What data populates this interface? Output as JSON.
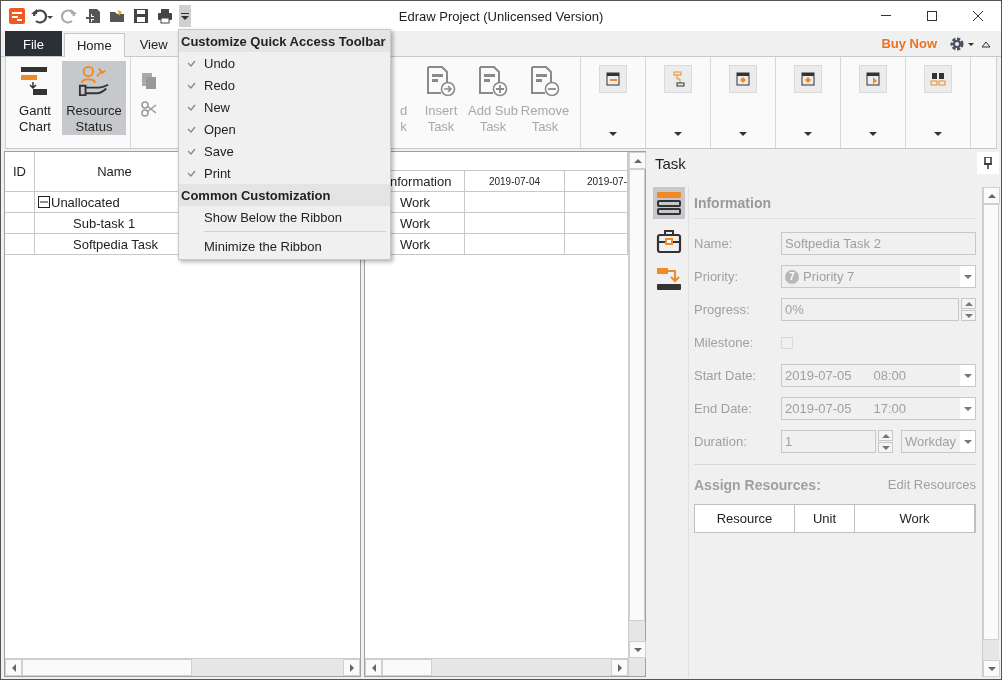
{
  "window": {
    "title": "Edraw Project (Unlicensed Version)"
  },
  "tabs": [
    {
      "label": "File",
      "kind": "file",
      "selected": false
    },
    {
      "label": "Home",
      "kind": "tab",
      "selected": true
    },
    {
      "label": "View",
      "kind": "tab",
      "selected": false
    }
  ],
  "buy_now": "Buy Now",
  "ribbon": {
    "view_buttons": [
      {
        "lines": [
          "Gantt",
          "Chart"
        ],
        "kind": "gantt",
        "selected": false
      },
      {
        "lines": [
          "Resource",
          "Status"
        ],
        "kind": "resource",
        "selected": true
      }
    ],
    "task_buttons": [
      {
        "lines": [
          "d",
          "k"
        ],
        "kind": "partial"
      },
      {
        "lines": [
          "Insert",
          "Task"
        ],
        "kind": "insert"
      },
      {
        "lines": [
          "Add Sub",
          "Task"
        ],
        "kind": "add"
      },
      {
        "lines": [
          "Remove",
          "Task"
        ],
        "kind": "remove"
      }
    ],
    "dropdown_groups": [
      {
        "kind": "bar"
      },
      {
        "kind": "link"
      },
      {
        "kind": "diamond"
      },
      {
        "kind": "diamond"
      },
      {
        "kind": "flag"
      },
      {
        "kind": "find"
      }
    ]
  },
  "task_table": {
    "columns": [
      "ID",
      "Name"
    ],
    "rows": [
      {
        "name": "Unallocated",
        "expanded": true,
        "children": [
          {
            "name": "Sub-task 1"
          },
          {
            "name": "Softpedia Task"
          }
        ]
      }
    ]
  },
  "gantt": {
    "columns": [
      "nformation",
      "2019-07-04",
      "2019-07-"
    ],
    "rows": [
      {
        "information": "Work"
      },
      {
        "information": "Work"
      },
      {
        "information": "Work"
      }
    ]
  },
  "task_panel": {
    "title": "Task",
    "side_tabs": [
      {
        "kind": "info",
        "selected": true
      },
      {
        "kind": "case",
        "selected": false
      },
      {
        "kind": "link",
        "selected": false
      }
    ],
    "section": "Information",
    "fields": [
      {
        "label": "Name:",
        "kind": "text",
        "value": "Softpedia Task 2"
      },
      {
        "label": "Priority:",
        "kind": "select",
        "badge": "7",
        "value": "Priority 7"
      },
      {
        "label": "Progress:",
        "kind": "spin",
        "value": "0%"
      },
      {
        "label": "Milestone:",
        "kind": "checkbox",
        "checked": false
      },
      {
        "label": "Start Date:",
        "kind": "datetime",
        "date": "2019-07-05",
        "time": "08:00"
      },
      {
        "label": "End Date:",
        "kind": "datetime",
        "date": "2019-07-05",
        "time": "17:00"
      },
      {
        "label": "Duration:",
        "kind": "duration",
        "value": "1",
        "unit": "Workday"
      }
    ],
    "assign_title": "Assign Resources:",
    "edit_link": "Edit Resources",
    "resource_columns": [
      "Resource",
      "Unit",
      "Work"
    ]
  },
  "quick_access_menu": {
    "title": "Customize Quick Access Toolbar",
    "items": [
      {
        "label": "Undo",
        "checked": true
      },
      {
        "label": "Redo",
        "checked": true
      },
      {
        "label": "New",
        "checked": true
      },
      {
        "label": "Open",
        "checked": true
      },
      {
        "label": "Save",
        "checked": true
      },
      {
        "label": "Print",
        "checked": true
      }
    ],
    "section": "Common Customization",
    "options": [
      "Show Below the Ribbon",
      "Minimize the Ribbon"
    ]
  }
}
